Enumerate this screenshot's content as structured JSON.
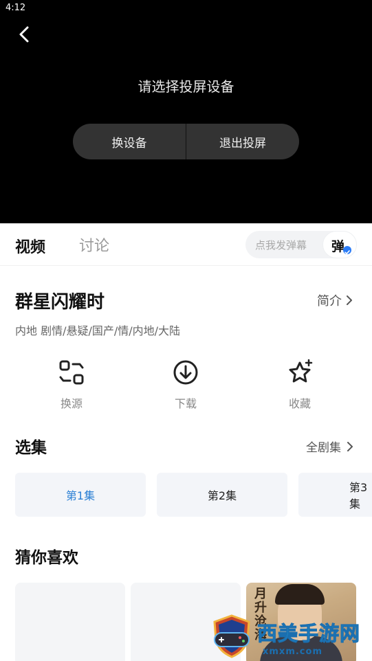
{
  "status_bar": {
    "time": "4:12"
  },
  "player": {
    "title": "请选择投屏设备",
    "buttons": {
      "change_device": "换设备",
      "exit_cast": "退出投屏"
    }
  },
  "tabs": {
    "video": "视频",
    "discuss": "讨论"
  },
  "danmu": {
    "placeholder": "点我发弹幕",
    "button": "弹"
  },
  "show": {
    "title": "群星闪耀时",
    "intro_label": "简介",
    "tags": "内地  剧情/悬疑/国产/情/内地/大陆"
  },
  "actions": [
    {
      "icon": "swap-source-icon",
      "label": "换源"
    },
    {
      "icon": "download-icon",
      "label": "下载"
    },
    {
      "icon": "favorite-star-icon",
      "label": "收藏"
    }
  ],
  "episodes": {
    "section_title": "选集",
    "all_label": "全剧集",
    "items": [
      "第1集",
      "第2集",
      "第3集"
    ],
    "active_index": 0,
    "active_color": "#2a7fd4"
  },
  "recommend": {
    "section_title": "猜你喜欢",
    "poster_text": "月升沧海"
  },
  "watermark": {
    "text": "西美手游网",
    "url": "xmxm.com"
  }
}
